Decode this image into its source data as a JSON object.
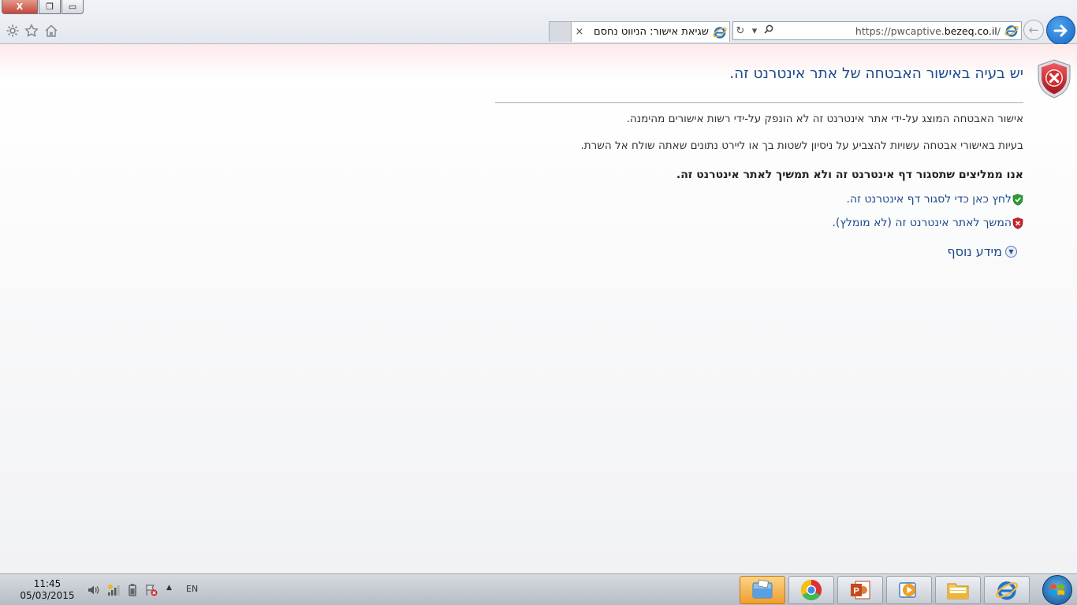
{
  "window": {
    "close_label": "X",
    "restore_label": "❐",
    "minimize_label": "▭"
  },
  "toolbar": {
    "settings_icon": "gear-icon",
    "favorites_icon": "star-icon",
    "home_icon": "home-icon"
  },
  "tab": {
    "title": "שגיאת אישור: הניווט נחסם",
    "close_label": "×"
  },
  "address_bar": {
    "url_prefix": "https://pwcaptive.",
    "url_domain": "bezeq.co.il",
    "url_suffix": "/",
    "refresh_label": "↻",
    "dropdown_label": "▾"
  },
  "nav": {
    "back_label": "←",
    "forward_label": "→"
  },
  "page": {
    "heading": "יש בעיה באישור האבטחה של אתר אינטרנט זה.",
    "description_1": "אישור האבטחה המוצג על-ידי אתר אינטרנט זה לא הונפק על-ידי רשות אישורים מהימנה.",
    "description_2": "בעיות באישורי אבטחה עשויות להצביע על ניסיון לשטות בך או ליירט נתונים שאתה שולח אל השרת.",
    "recommendation": "אנו ממליצים שתסגור דף אינטרנט זה ולא תמשיך לאתר אינטרנט זה.",
    "close_link": "לחץ כאן כדי לסגור דף אינטרנט זה.",
    "continue_link": "המשך לאתר אינטרנט זה (לא מומלץ).",
    "more_info": "מידע נוסף"
  },
  "taskbar": {
    "time": "11:45",
    "date": "05/03/2015",
    "language": "EN",
    "tray_up_arrow": "▲",
    "apps": [
      "explorer",
      "chrome",
      "powerpoint",
      "media-player",
      "file-manager",
      "internet-explorer"
    ]
  },
  "colors": {
    "link": "#1c4b8c",
    "shield_red": "#c8252b",
    "shield_green": "#2e9b35",
    "accent_blue": "#1566c4"
  }
}
